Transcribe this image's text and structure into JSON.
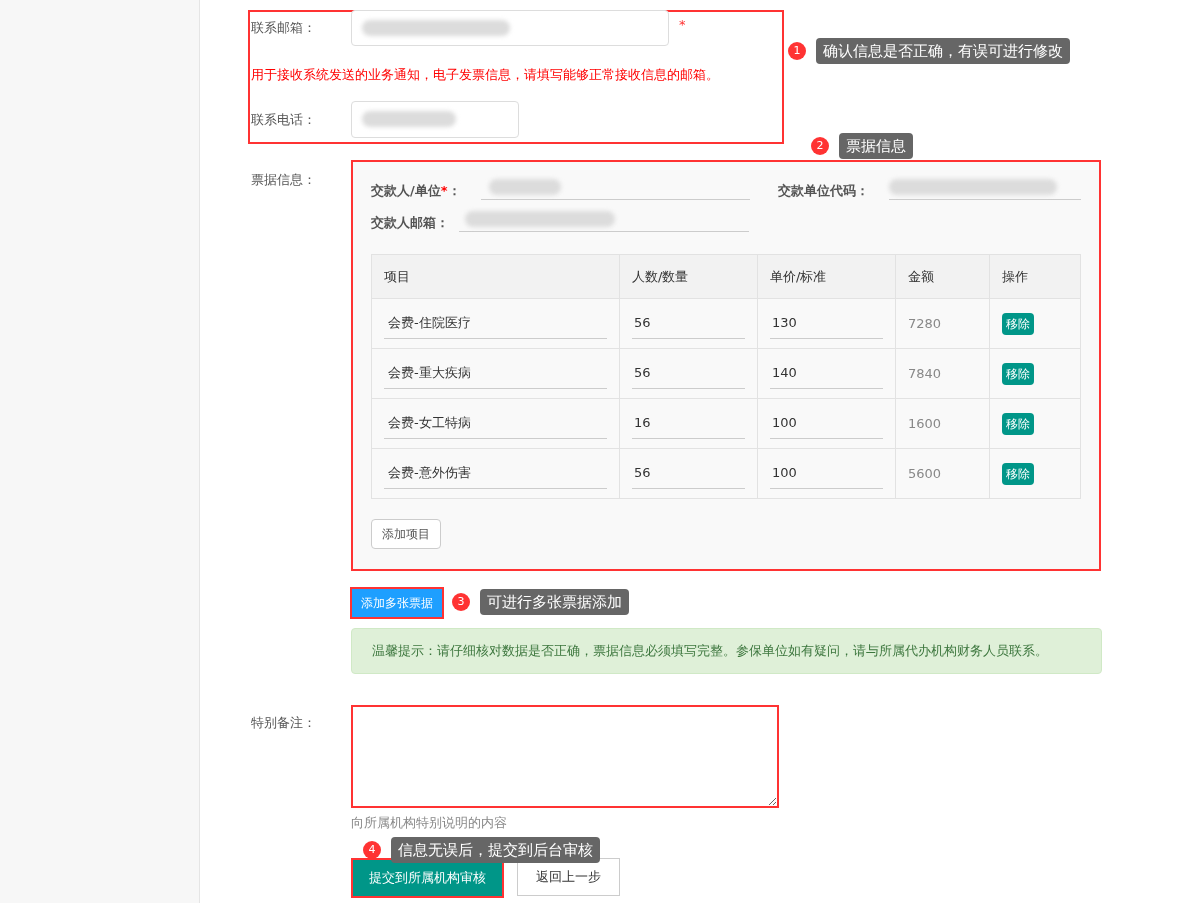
{
  "contact": {
    "email": {
      "label": "联系邮箱：",
      "required_mark": "*"
    },
    "email_hint": "用于接收系统发送的业务通知，电子发票信息，请填写能够正常接收信息的邮箱。",
    "phone": {
      "label": "联系电话："
    }
  },
  "ticket": {
    "label": "票据信息：",
    "payer": {
      "label": "交款人/单位",
      "required_mark": "*",
      "suffix": "："
    },
    "payer_code": {
      "label": "交款单位代码："
    },
    "payer_email": {
      "label": "交款人邮箱："
    },
    "columns": [
      "项目",
      "人数/数量",
      "单价/标准",
      "金额",
      "操作"
    ],
    "rows": [
      {
        "item": "会费-住院医疗",
        "quantity": "56",
        "price": "130",
        "amount": "7280",
        "action": "移除"
      },
      {
        "item": "会费-重大疾病",
        "quantity": "56",
        "price": "140",
        "amount": "7840",
        "action": "移除"
      },
      {
        "item": "会费-女工特病",
        "quantity": "16",
        "price": "100",
        "amount": "1600",
        "action": "移除"
      },
      {
        "item": "会费-意外伤害",
        "quantity": "56",
        "price": "100",
        "amount": "5600",
        "action": "移除"
      }
    ],
    "add_item_button": "添加项目"
  },
  "add_ticket_button": "添加多张票据",
  "notice": "温馨提示：请仔细核对数据是否正确，票据信息必须填写完整。参保单位如有疑问，请与所属代办机构财务人员联系。",
  "remarks": {
    "label": "特别备注：",
    "help": "向所属机构特别说明的内容"
  },
  "buttons": [
    {
      "label": "提交到所属机构审核",
      "kind": "primary"
    },
    {
      "label": "返回上一步",
      "kind": "default"
    }
  ],
  "annotations": [
    {
      "number": "1",
      "text": "确认信息是否正确，有误可进行修改"
    },
    {
      "number": "2",
      "text": "票据信息"
    },
    {
      "number": "3",
      "text": "可进行多张票据添加"
    },
    {
      "number": "4",
      "text": "信息无误后，提交到后台审核"
    }
  ]
}
